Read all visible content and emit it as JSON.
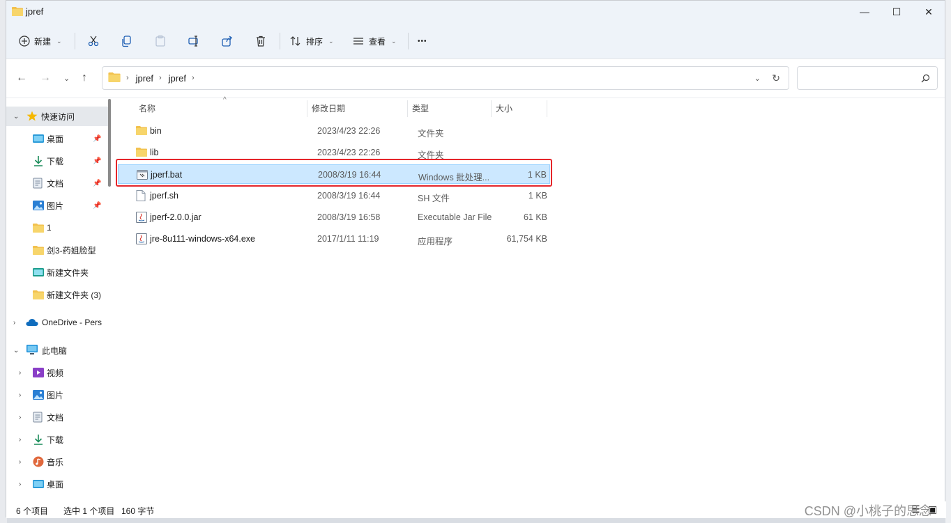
{
  "window": {
    "title": "jpref",
    "controls": [
      "minimize",
      "maximize",
      "close"
    ]
  },
  "toolbar": {
    "new_label": "新建",
    "sort_label": "排序",
    "view_label": "查看",
    "more_label": "•••"
  },
  "address": {
    "crumbs": [
      "jpref",
      "jpref"
    ]
  },
  "navpane": {
    "quick_access": "快速访问",
    "items": [
      {
        "label": "桌面",
        "pinned": true
      },
      {
        "label": "下载",
        "pinned": true
      },
      {
        "label": "文档",
        "pinned": true
      },
      {
        "label": "图片",
        "pinned": true
      },
      {
        "label": "1"
      },
      {
        "label": "剑3-药姐脸型"
      },
      {
        "label": "新建文件夹"
      },
      {
        "label": "新建文件夹 (3)"
      }
    ],
    "onedrive": "OneDrive - Pers",
    "this_pc": "此电脑",
    "pc_items": [
      {
        "label": "视频"
      },
      {
        "label": "图片"
      },
      {
        "label": "文档"
      },
      {
        "label": "下载"
      },
      {
        "label": "音乐"
      },
      {
        "label": "桌面"
      }
    ]
  },
  "columns": {
    "name": "名称",
    "date": "修改日期",
    "type": "类型",
    "size": "大小"
  },
  "files": [
    {
      "name": "bin",
      "date": "2023/4/23 22:26",
      "type": "文件夹",
      "size": "",
      "icon": "folder-icon"
    },
    {
      "name": "lib",
      "date": "2023/4/23 22:26",
      "type": "文件夹",
      "size": "",
      "icon": "folder-icon"
    },
    {
      "name": "jperf.bat",
      "date": "2008/3/19 16:44",
      "type": "Windows 批处理...",
      "size": "1 KB",
      "icon": "batch-file-icon",
      "selected": true
    },
    {
      "name": "jperf.sh",
      "date": "2008/3/19 16:44",
      "type": "SH 文件",
      "size": "1 KB",
      "icon": "file-icon"
    },
    {
      "name": "jperf-2.0.0.jar",
      "date": "2008/3/19 16:58",
      "type": "Executable Jar File",
      "size": "61 KB",
      "icon": "jar-file-icon"
    },
    {
      "name": "jre-8u111-windows-x64.exe",
      "date": "2017/1/11 11:19",
      "type": "应用程序",
      "size": "61,754 KB",
      "icon": "exe-file-icon"
    }
  ],
  "status": {
    "count": "6 个项目",
    "selected": "选中 1 个项目",
    "bytes": "160 字节"
  },
  "watermark": "CSDN @小桃子的思念",
  "colors": {
    "accent_red": "#e5262b",
    "selection": "#cce8ff",
    "folder": "#f2c14e"
  }
}
